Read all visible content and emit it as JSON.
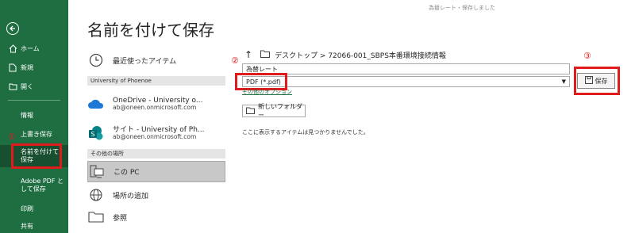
{
  "window": {
    "title": "為替レート・保存しました"
  },
  "sidebar": {
    "items": [
      {
        "label": "ホーム",
        "icon": "home-icon"
      },
      {
        "label": "新規",
        "icon": "new-file-icon"
      },
      {
        "label": "開く",
        "icon": "open-folder-icon"
      },
      {
        "label": "情報"
      },
      {
        "label": "上書き保存"
      },
      {
        "label": "名前を付けて保存"
      },
      {
        "label": "Adobe PDF として保存"
      },
      {
        "label": "印刷"
      },
      {
        "label": "共有"
      }
    ]
  },
  "page": {
    "title": "名前を付けて保存"
  },
  "locations": {
    "recent": "最近使ったアイテム",
    "org_section": "University of Phoenoe",
    "onedrive": {
      "name": "OneDrive - University o...",
      "email": "ab@oneen.onmicrosoft.com"
    },
    "site": {
      "name": "サイト - University of Ph...",
      "email": "ab@oneen.onmicrosoft.com"
    },
    "other_section": "その他の場所",
    "this_pc": "この PC",
    "add_place": "場所の追加",
    "browse": "参照"
  },
  "panel": {
    "breadcrumb": "デスクトップ > 72066-001_SBPS本番環境接続情報",
    "filename": "為替レート",
    "filetype": "PDF (*.pdf)",
    "more_options": "その他のオプション",
    "save_label": "保存",
    "new_folder": "新しいフォルダー",
    "empty_message": "ここに表示するアイテムは見つかりませんでした。"
  },
  "annotations": {
    "one": "①",
    "two": "②",
    "three": "③"
  },
  "colors": {
    "sidebar": "#1e6e42",
    "highlight": "#e01b1b"
  }
}
